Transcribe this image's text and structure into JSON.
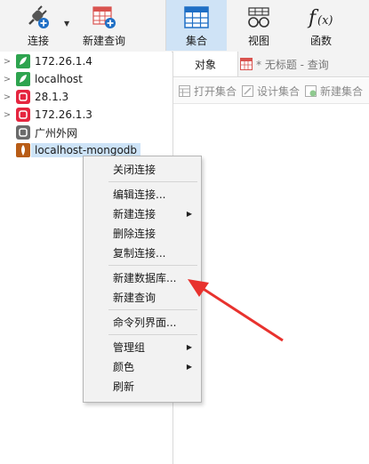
{
  "toolbar": {
    "connect_label": "连接",
    "new_query_label": "新建查询",
    "collection_label": "集合",
    "view_label": "视图",
    "function_label": "函数"
  },
  "tree": {
    "items": [
      {
        "label": "172.26.1.4",
        "icon": "green-leaf-connection-icon"
      },
      {
        "label": "localhost",
        "icon": "green-leaf-connection-icon"
      },
      {
        "label": "28.1.3",
        "icon": "red-db-connection-icon"
      },
      {
        "label": "172.26.1.3",
        "icon": "red-db-connection-icon"
      },
      {
        "label": "广州外网",
        "icon": "gray-db-connection-icon"
      },
      {
        "label": "localhost-mongodb",
        "icon": "mongodb-leaf-icon"
      }
    ]
  },
  "tabs": {
    "objects": "对象",
    "query": "* 无标题 - 查询"
  },
  "subtoolbar": {
    "open_collection": "打开集合",
    "design_collection": "设计集合",
    "new_collection": "新建集合"
  },
  "context_menu": {
    "close_connection": "关闭连接",
    "edit_connection": "编辑连接...",
    "new_connection": "新建连接",
    "delete_connection": "删除连接",
    "copy_connection": "复制连接...",
    "new_database": "新建数据库...",
    "new_query": "新建查询",
    "command_line": "命令列界面...",
    "manage_group": "管理组",
    "color": "颜色",
    "refresh": "刷新"
  },
  "colors": {
    "accent_blue": "#1f6fc5",
    "selection_bg": "#cde3f7",
    "annotation_red": "#e8322e"
  }
}
